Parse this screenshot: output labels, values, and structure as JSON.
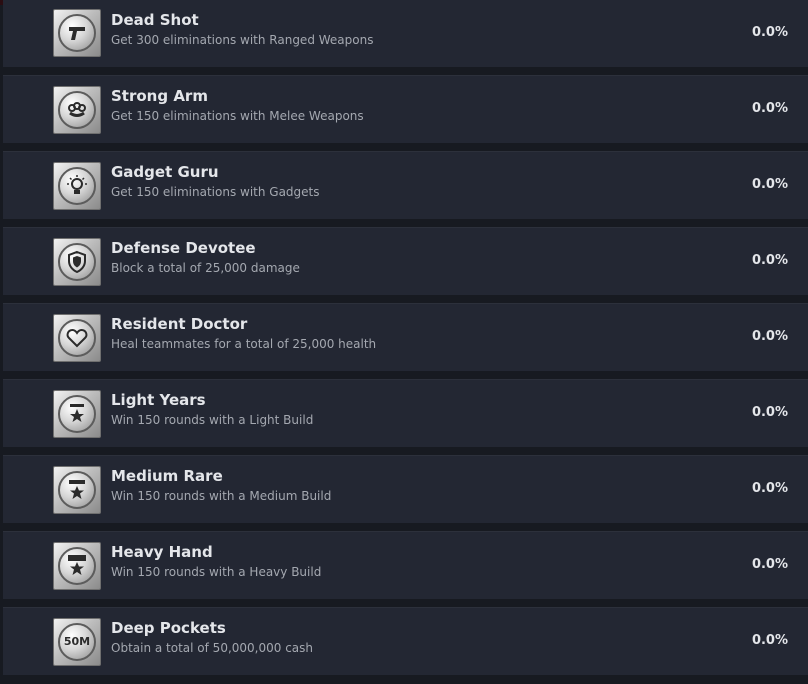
{
  "achievements": [
    {
      "title": "Dead Shot",
      "description": "Get 300 eliminations with Ranged Weapons",
      "percent": "0.0%",
      "icon": "pistol-icon"
    },
    {
      "title": "Strong Arm",
      "description": "Get 150 eliminations with Melee Weapons",
      "percent": "0.0%",
      "icon": "brass-knuckles-icon"
    },
    {
      "title": "Gadget Guru",
      "description": "Get 150 eliminations with Gadgets",
      "percent": "0.0%",
      "icon": "lightbulb-icon"
    },
    {
      "title": "Defense Devotee",
      "description": "Block a total of 25,000 damage",
      "percent": "0.0%",
      "icon": "shield-icon"
    },
    {
      "title": "Resident Doctor",
      "description": "Heal teammates for a total of 25,000 health",
      "percent": "0.0%",
      "icon": "heart-icon"
    },
    {
      "title": "Light Years",
      "description": "Win 150 rounds with a Light Build",
      "percent": "0.0%",
      "icon": "light-build-star-icon"
    },
    {
      "title": "Medium Rare",
      "description": "Win 150 rounds with a Medium Build",
      "percent": "0.0%",
      "icon": "medium-build-star-icon"
    },
    {
      "title": "Heavy Hand",
      "description": "Win 150 rounds with a Heavy Build",
      "percent": "0.0%",
      "icon": "heavy-build-star-icon"
    },
    {
      "title": "Deep Pockets",
      "description": "Obtain a total of 50,000,000 cash",
      "percent": "0.0%",
      "icon": "cash-50m-icon",
      "icon_text": "50M"
    }
  ],
  "colors": {
    "background": "#171a21",
    "row_background": "#232733",
    "title_text": "#e4e6ea",
    "description_text": "#a4a8b0",
    "top_accent": "#5c1018"
  }
}
